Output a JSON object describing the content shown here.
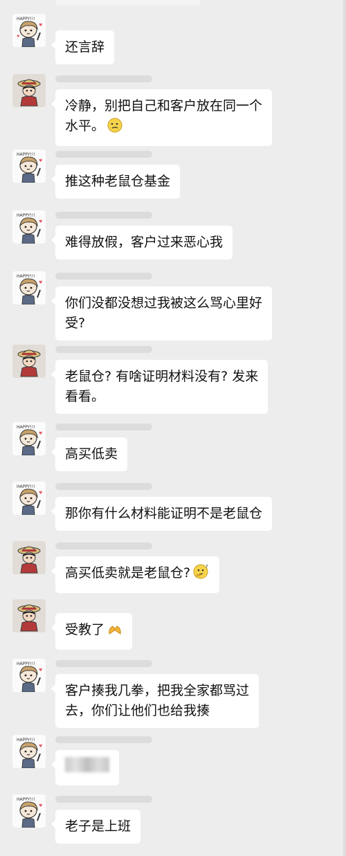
{
  "messages": [
    {
      "sender": "girl",
      "text": "还言辞"
    },
    {
      "sender": "luffy",
      "lines": [
        "冷静，别把自己和客户放在同一个",
        "水平。"
      ],
      "emoji": "smirk-face"
    },
    {
      "sender": "girl",
      "text": "推这种老鼠仓基金"
    },
    {
      "sender": "girl",
      "text": "难得放假，客户过来恶心我"
    },
    {
      "sender": "girl",
      "lines": [
        "你们没都没想过我被这么骂心里好",
        "受?"
      ]
    },
    {
      "sender": "luffy",
      "lines": [
        "老鼠仓? 有啥证明材料没有? 发来",
        "看看。"
      ]
    },
    {
      "sender": "girl",
      "text": "高买低卖"
    },
    {
      "sender": "girl",
      "text": "那你有什么材料能证明不是老鼠仓"
    },
    {
      "sender": "luffy",
      "text": "高买低卖就是老鼠仓?",
      "emoji": "thinking-face"
    },
    {
      "sender": "luffy",
      "text": "受教了",
      "emoji": "fist-salute"
    },
    {
      "sender": "girl",
      "lines": [
        "客户揍我几拳，把我全家都骂过",
        "去，你们让他们也给我揍"
      ]
    },
    {
      "sender": "girl",
      "blurred": true
    },
    {
      "sender": "girl",
      "text": "老子是上班"
    }
  ],
  "avatar_labels": {
    "girl": "HAPPY!!!"
  }
}
